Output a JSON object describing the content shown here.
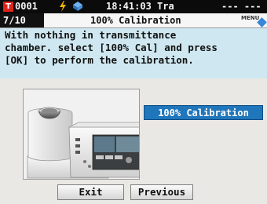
{
  "status": {
    "t_icon": "T",
    "counter": "0001",
    "time": "18:41:03 Tra",
    "placeholder": "--- ---"
  },
  "header": {
    "page": "7/10",
    "title": "100% Calibration",
    "menu_label": "MENU"
  },
  "instruction": {
    "lines": [
      "With nothing in transmittance",
      "chamber. select [100% Cal] and press",
      "[OK] to perform the calibration."
    ]
  },
  "main": {
    "calibration_button": "100% Calibration"
  },
  "footer": {
    "exit_label": "Exit",
    "previous_label": "Previous"
  },
  "icons": {
    "status_mode": "t-icon",
    "power": "bolt-icon",
    "connection": "diamond-icon",
    "menu": "menu-icon"
  },
  "colors": {
    "status_bar": "#0b0b0b",
    "instruction_bg": "#cfe7f0",
    "accent_button": "#1f76bb",
    "t_icon": "#e0241b",
    "bolt": "#f0b400",
    "diamond": "#4a90d9"
  }
}
